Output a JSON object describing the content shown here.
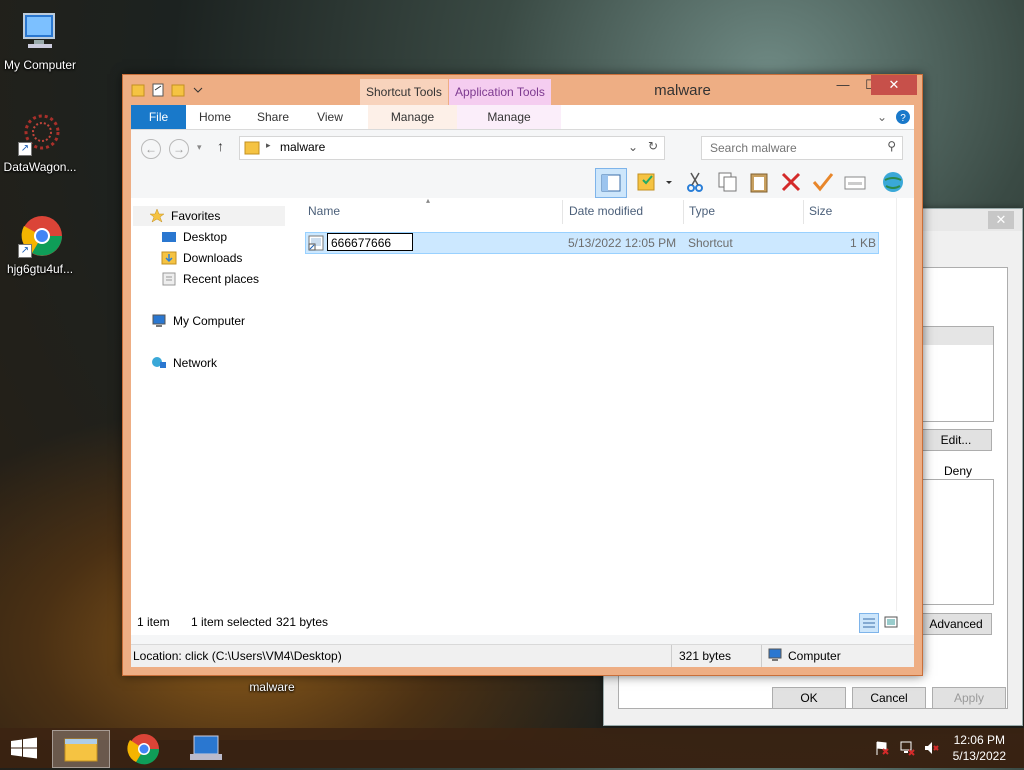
{
  "desktop": {
    "icons": [
      {
        "label": "My Computer"
      },
      {
        "label": "DataWagon..."
      },
      {
        "label": "hjg6gtu4uf..."
      },
      {
        "label": "malware"
      }
    ]
  },
  "explorer": {
    "title": "malware",
    "context_tabs": {
      "shortcut_tools": "Shortcut Tools",
      "application_tools": "Application Tools",
      "manage1": "Manage",
      "manage2": "Manage"
    },
    "window_buttons": {
      "minimize": "—",
      "maximize": "☐",
      "close": "✕"
    },
    "ribbon_tabs": [
      "File",
      "Home",
      "Share",
      "View"
    ],
    "address": {
      "path_item": "malware"
    },
    "search": {
      "placeholder": "Search malware"
    },
    "navigation": {
      "favorites": "Favorites",
      "desktop": "Desktop",
      "downloads": "Downloads",
      "recent_places": "Recent places",
      "my_computer": "My Computer",
      "network": "Network"
    },
    "columns": {
      "name": "Name",
      "date_modified": "Date modified",
      "type": "Type",
      "size": "Size"
    },
    "files": [
      {
        "name": "666677666",
        "date_modified": "5/13/2022 12:05 PM",
        "type": "Shortcut",
        "size": "1 KB"
      }
    ],
    "status": {
      "items": "1 item",
      "selected": "1 item selected",
      "bytes": "321 bytes"
    },
    "location_bar": {
      "location": "Location: click (C:\\Users\\VM4\\Desktop)",
      "bytes": "321 bytes",
      "zone": "Computer"
    }
  },
  "dialog": {
    "close": "✕",
    "edit_button": "Edit...",
    "deny_label": "Deny",
    "advanced_button": "Advanced",
    "ok_button": "OK",
    "cancel_button": "Cancel",
    "apply_button": "Apply"
  },
  "taskbar": {
    "time": "12:06 PM",
    "date": "5/13/2022"
  },
  "colors": {
    "accent": "#1979ca",
    "window_frame": "#eeae84",
    "selection": "#cce8ff"
  }
}
